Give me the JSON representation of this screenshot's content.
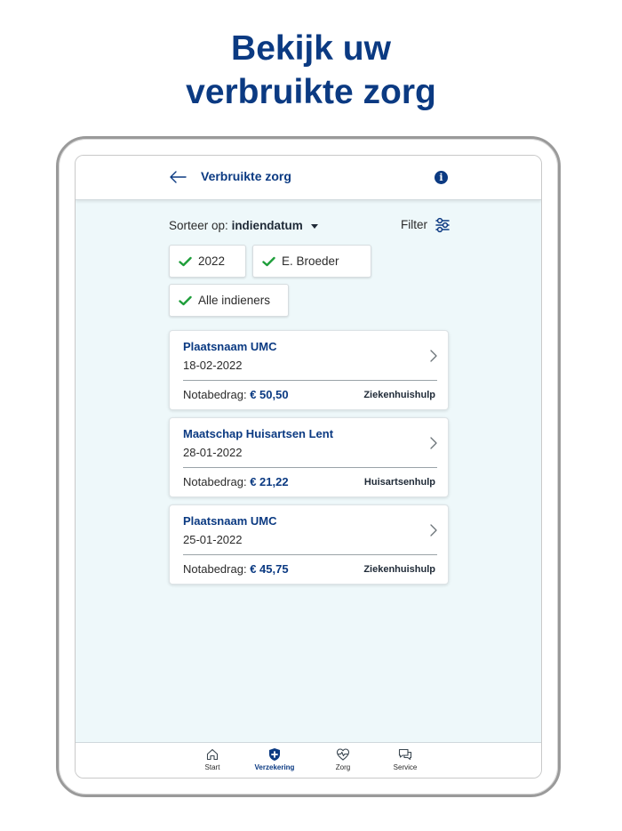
{
  "headline": {
    "line1": "Bekijk uw",
    "line2": "verbruikte zorg"
  },
  "header": {
    "title": "Verbruikte zorg",
    "back_icon": "arrow-left-icon",
    "info_icon": "info-icon"
  },
  "sort": {
    "prefix": "Sorteer op:",
    "value": "indiendatum"
  },
  "filter": {
    "label": "Filter",
    "icon": "sliders-icon"
  },
  "chips": [
    {
      "label": "2022"
    },
    {
      "label": "E. Broeder"
    },
    {
      "label": "Alle indieners"
    }
  ],
  "claims": [
    {
      "title": "Plaatsnaam UMC",
      "date": "18-02-2022",
      "amount_label": "Notabedrag:",
      "amount": "€ 50,50",
      "category": "Ziekenhuishulp"
    },
    {
      "title": "Maatschap Huisartsen Lent",
      "date": "28-01-2022",
      "amount_label": "Notabedrag:",
      "amount": "€ 21,22",
      "category": "Huisartsenhulp"
    },
    {
      "title": "Plaatsnaam UMC",
      "date": "25-01-2022",
      "amount_label": "Notabedrag:",
      "amount": "€ 45,75",
      "category": "Ziekenhuishulp"
    }
  ],
  "nav": [
    {
      "label": "Start",
      "icon": "home-icon",
      "active": false
    },
    {
      "label": "Verzekering",
      "icon": "shield-plus-icon",
      "active": true
    },
    {
      "label": "Zorg",
      "icon": "heart-pulse-icon",
      "active": false
    },
    {
      "label": "Service",
      "icon": "chat-bubbles-icon",
      "active": false
    }
  ],
  "colors": {
    "brand": "#0b3a82",
    "check": "#1e9e3a",
    "screen_bg": "#eef8fa"
  }
}
